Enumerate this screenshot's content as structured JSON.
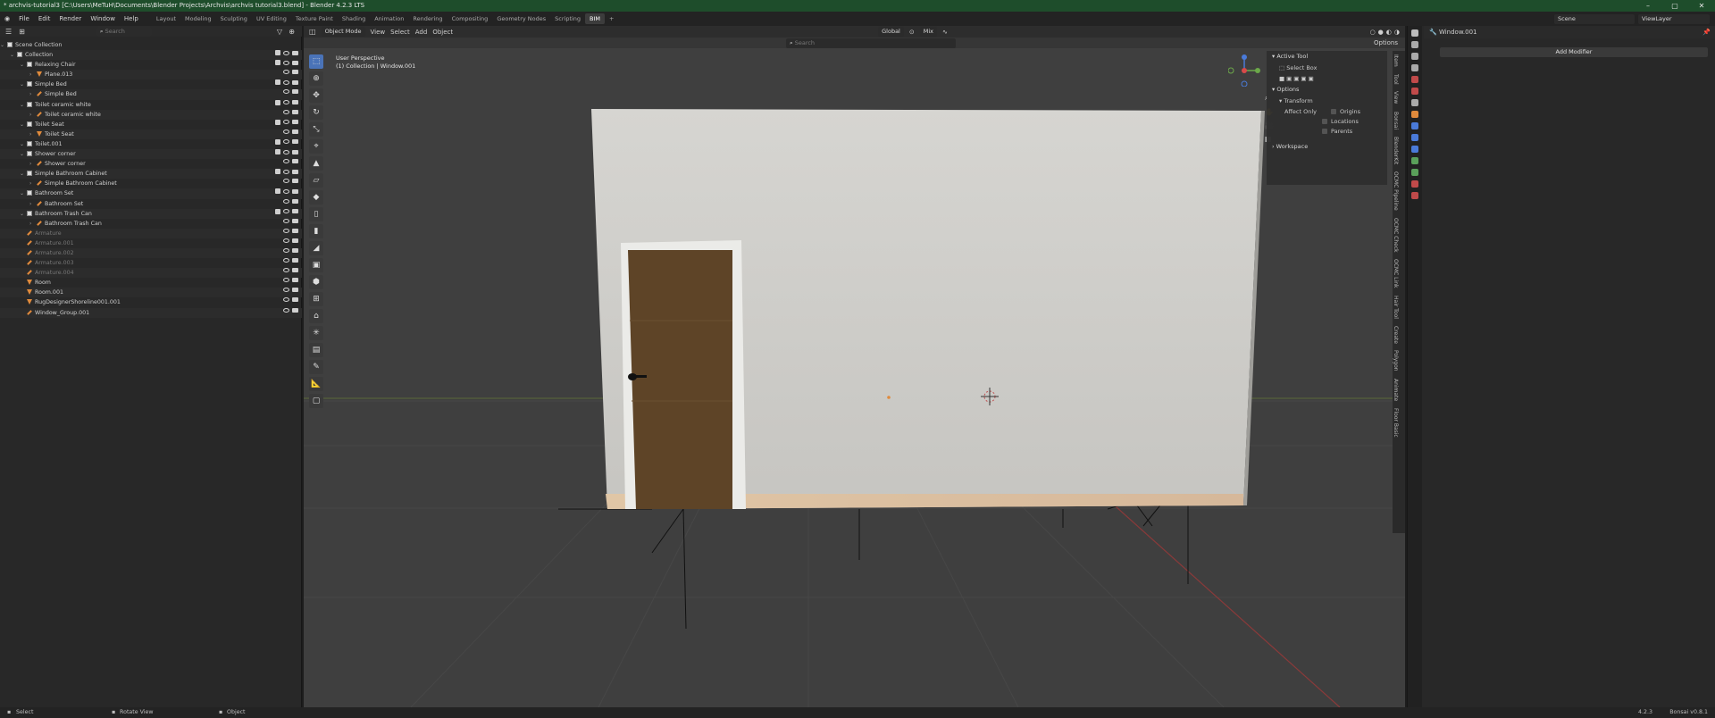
{
  "titlebar": {
    "title": "* archvis-tutorial3 [C:\\Users\\MeTuH\\Documents\\Blender Projects\\Archvis\\archvis tutorial3.blend] - Blender 4.2.3 LTS"
  },
  "menu": {
    "items": [
      "File",
      "Edit",
      "Render",
      "Window",
      "Help"
    ],
    "workspaces": [
      "Layout",
      "Modeling",
      "Sculpting",
      "UV Editing",
      "Texture Paint",
      "Shading",
      "Animation",
      "Rendering",
      "Compositing",
      "Geometry Nodes",
      "Scripting",
      "BIM"
    ],
    "active_workspace": "BIM",
    "scene": "Scene",
    "view_layer": "ViewLayer"
  },
  "outliner": {
    "search_placeholder": "Search",
    "rows": [
      {
        "label": "Scene Collection",
        "type": "coll",
        "indent": 0
      },
      {
        "label": "Collection",
        "type": "coll",
        "indent": 1
      },
      {
        "label": "Relaxing Chair",
        "type": "coll",
        "indent": 2
      },
      {
        "label": "Plane.013",
        "type": "obj",
        "indent": 3
      },
      {
        "label": "Simple Bed",
        "type": "coll",
        "indent": 2
      },
      {
        "label": "Simple Bed",
        "type": "arm",
        "indent": 3
      },
      {
        "label": "Toilet ceramic white",
        "type": "coll",
        "indent": 2
      },
      {
        "label": "Toilet ceramic white",
        "type": "arm",
        "indent": 3
      },
      {
        "label": "Toilet Seat",
        "type": "coll",
        "indent": 2
      },
      {
        "label": "Toilet Seat",
        "type": "obj",
        "indent": 3
      },
      {
        "label": "Toilet.001",
        "type": "coll",
        "indent": 2
      },
      {
        "label": "Shower corner",
        "type": "coll",
        "indent": 2
      },
      {
        "label": "Shower corner",
        "type": "arm",
        "indent": 3
      },
      {
        "label": "Simple Bathroom Cabinet",
        "type": "coll",
        "indent": 2
      },
      {
        "label": "Simple Bathroom Cabinet",
        "type": "arm",
        "indent": 3
      },
      {
        "label": "Bathroom Set",
        "type": "coll",
        "indent": 2
      },
      {
        "label": "Bathroom Set",
        "type": "arm",
        "indent": 3
      },
      {
        "label": "Bathroom Trash Can",
        "type": "coll",
        "indent": 2
      },
      {
        "label": "Bathroom Trash Can",
        "type": "arm",
        "indent": 3
      },
      {
        "label": "Armature",
        "type": "arm",
        "indent": 2,
        "dim": true
      },
      {
        "label": "Armature.001",
        "type": "arm",
        "indent": 2,
        "dim": true
      },
      {
        "label": "Armature.002",
        "type": "arm",
        "indent": 2,
        "dim": true
      },
      {
        "label": "Armature.003",
        "type": "arm",
        "indent": 2,
        "dim": true
      },
      {
        "label": "Armature.004",
        "type": "arm",
        "indent": 2,
        "dim": true
      },
      {
        "label": "Room",
        "type": "obj",
        "indent": 2
      },
      {
        "label": "Room.001",
        "type": "obj",
        "indent": 2
      },
      {
        "label": "RugDesignerShoreline001.001",
        "type": "obj",
        "indent": 2
      },
      {
        "label": "Window_Group.001",
        "type": "arm",
        "indent": 2
      }
    ]
  },
  "viewport": {
    "mode": "Object Mode",
    "menus": [
      "View",
      "Select",
      "Add",
      "Object"
    ],
    "orientation": "Global",
    "pivot": "Mix",
    "search_placeholder": "Search",
    "options": "Options",
    "info_line1": "User Perspective",
    "info_line2": "(1) Collection | Window.001",
    "npanel": {
      "active_tool": "Active Tool",
      "tool_name": "Select Box",
      "options": "Options",
      "transform": "Transform",
      "affect_only": "Affect Only",
      "origins": "Origins",
      "locations": "Locations",
      "parents": "Parents",
      "workspace": "Workspace"
    },
    "side_tabs": [
      "Item",
      "Tool",
      "View",
      "Bonsai",
      "BlenderKit",
      "OCMC Pipeline",
      "OCMC Check",
      "OCMC Link",
      "Hair Tool",
      "Create",
      "Polygon",
      "Animate",
      "Floor Basic"
    ]
  },
  "properties": {
    "object": "Window.001",
    "add_modifier": "Add Modifier"
  },
  "statusbar": {
    "select": "Select",
    "rotate": "Rotate View",
    "object": "Object",
    "version": "4.2.3",
    "addon": "Bonsai v0.8.1"
  },
  "colors": {
    "wall": "#cbcac6",
    "door": "#5e4427",
    "grid": "#474747",
    "xaxis": "#8a3a3a"
  }
}
